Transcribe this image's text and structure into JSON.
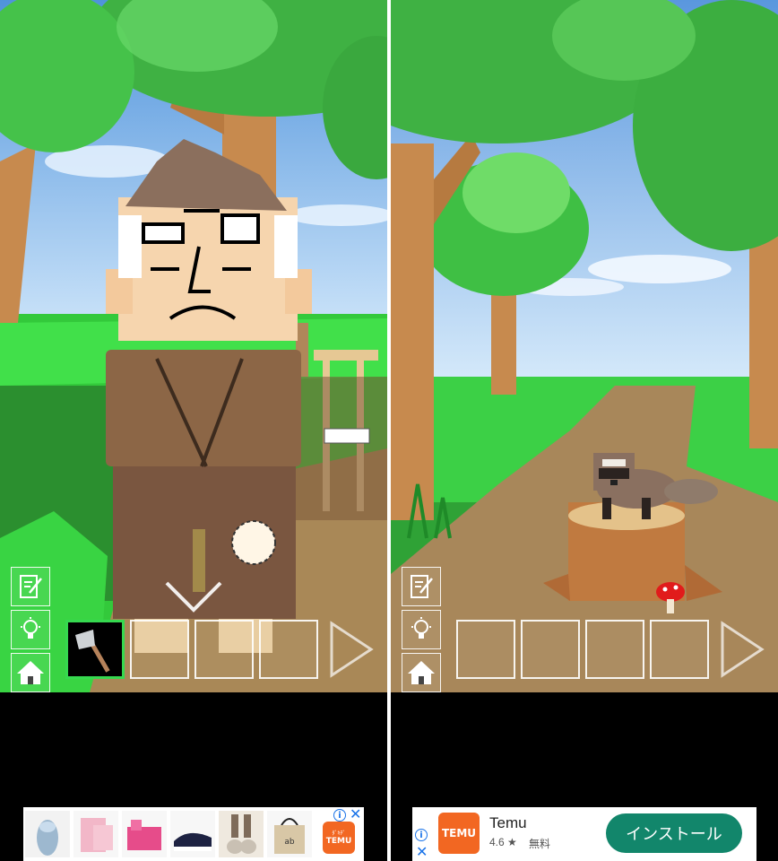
{
  "left_screen": {
    "scene": "villager-with-tree",
    "menu": {
      "memo_icon": "memo-icon",
      "hint_icon": "lightbulb-icon",
      "home_icon": "home-icon"
    },
    "inventory": {
      "selected_item": "axe-icon",
      "slots_count": 4
    },
    "ad": {
      "products": [
        "sandals",
        "pink-wallet",
        "pink-organizer",
        "black-sneakers",
        "lace-slip-ons",
        "tote-bag"
      ],
      "logo_text_top": "ﾀﾞｷﾁﾞ",
      "logo_text": "TEMU",
      "info_icon": "i",
      "close_icon": "✕"
    }
  },
  "right_screen": {
    "scene": "tanuki-on-stump",
    "menu": {
      "memo_icon": "memo-icon",
      "hint_icon": "lightbulb-icon",
      "home_icon": "home-icon"
    },
    "inventory": {
      "slots_count": 4
    },
    "ad": {
      "app_name": "Temu",
      "rating": "4.6 ★",
      "price": "無料",
      "logo_text": "TEMU",
      "install_label": "インストール",
      "info_icon": "i",
      "close_icon": "✕"
    }
  }
}
